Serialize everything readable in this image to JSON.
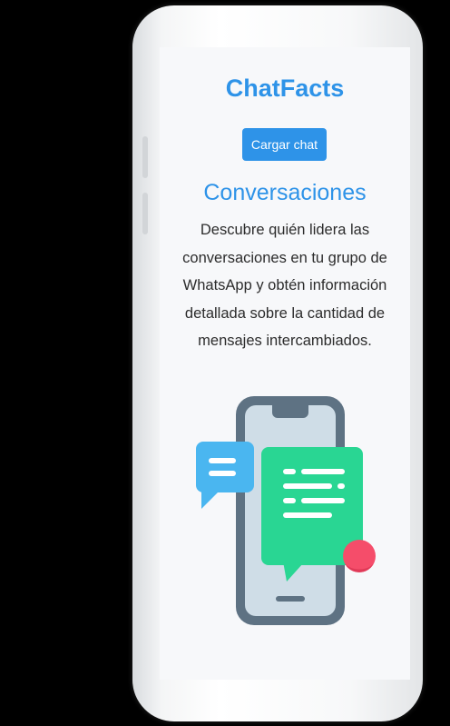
{
  "app": {
    "title": "ChatFacts"
  },
  "actions": {
    "load_chat_label": "Cargar chat"
  },
  "section": {
    "title": "Conversaciones",
    "description": "Descubre quién lidera las conversaciones en tu grupo de WhatsApp y obtén información detallada sobre la cantidad de mensajes intercambiados."
  },
  "colors": {
    "accent": "#2e93e8",
    "bubble_green": "#29d693",
    "bubble_blue": "#4ab6f0",
    "badge_red": "#f54d6a",
    "phone_frame": "#5e7283"
  },
  "illustration": {
    "icon": "chat-phone-illustration"
  }
}
